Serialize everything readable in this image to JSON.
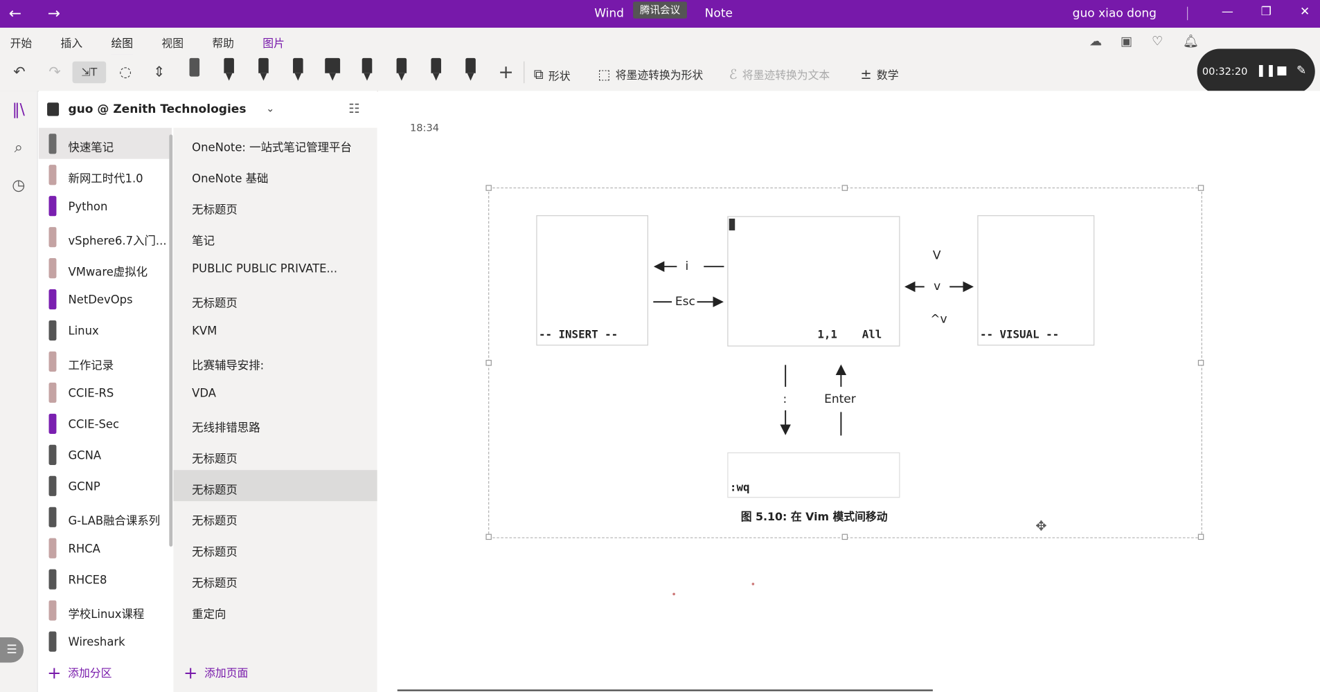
{
  "titlebar": {
    "title_left": "Wind",
    "title_right": "Note",
    "meeting_badge": "腾讯会议",
    "user": "guo xiao dong",
    "back_icon": "arrow-left-icon",
    "forward_icon": "arrow-right-icon"
  },
  "menu": {
    "tabs": [
      "开始",
      "插入",
      "绘图",
      "视图",
      "帮助",
      "图片"
    ],
    "active_tab": "绘图"
  },
  "ribbon": {
    "shape_label": "形状",
    "ink_to_shape_label": "将墨迹转换为形状",
    "ink_to_text_label": "将墨迹转换为文本",
    "math_label": "数学"
  },
  "recording": {
    "elapsed": "00:32:20"
  },
  "notebook": {
    "name": "guo @ Zenith Technologies",
    "sections": [
      {
        "label": "快速笔记",
        "color": "#6b6b6b"
      },
      {
        "label": "新网工时代1.0",
        "color": "#c4a3a3"
      },
      {
        "label": "Python",
        "color": "#7a1fb0"
      },
      {
        "label": "vSphere6.7入门...",
        "color": "#c4a3a3"
      },
      {
        "label": "VMware虚拟化",
        "color": "#c4a3a3"
      },
      {
        "label": "NetDevOps",
        "color": "#7a1fb0"
      },
      {
        "label": "Linux",
        "color": "#555555"
      },
      {
        "label": "工作记录",
        "color": "#c4a3a3"
      },
      {
        "label": "CCIE-RS",
        "color": "#c4a3a3"
      },
      {
        "label": "CCIE-Sec",
        "color": "#7a1fb0"
      },
      {
        "label": "GCNA",
        "color": "#555555"
      },
      {
        "label": "GCNP",
        "color": "#555555"
      },
      {
        "label": "G-LAB融合课系列",
        "color": "#555555"
      },
      {
        "label": "RHCA",
        "color": "#c4a3a3"
      },
      {
        "label": "RHCE8",
        "color": "#555555"
      },
      {
        "label": "学校Linux课程",
        "color": "#c4a3a3"
      },
      {
        "label": "Wireshark",
        "color": "#555555"
      }
    ],
    "add_section": "添加分区",
    "pages": [
      "OneNote: 一站式笔记管理平台",
      "OneNote 基础",
      "无标题页",
      "笔记",
      "PUBLIC        PUBLIC PRIVATE...",
      "无标题页",
      "KVM",
      "比赛辅导安排:",
      "VDA",
      "无线排错思路",
      "无标题页",
      "无标题页",
      "无标题页",
      "无标题页",
      "无标题页",
      "重定向"
    ],
    "active_page_index": 11,
    "add_page": "添加页面"
  },
  "canvas": {
    "page_time": "18:34",
    "insert_mode": "-- INSERT --",
    "visual_mode": "-- VISUAL --",
    "position": "1,1",
    "all": "All",
    "key_i": "i",
    "key_esc": "Esc",
    "key_V": "V",
    "key_v": "v",
    "key_ctrl_v": "^v",
    "key_colon": ":",
    "key_enter": "Enter",
    "command": ":wq",
    "caption": "图 5.10: 在 Vim 模式间移动"
  }
}
